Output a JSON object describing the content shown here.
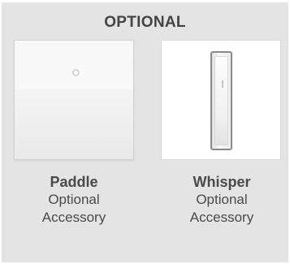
{
  "heading": "OPTIONAL",
  "items": [
    {
      "name": "Paddle",
      "line1": "Optional",
      "line2": "Accessory"
    },
    {
      "name": "Whisper",
      "line1": "Optional",
      "line2": "Accessory"
    }
  ],
  "colors": {
    "panel_background": "#e4e4e4",
    "text": "#444444"
  }
}
